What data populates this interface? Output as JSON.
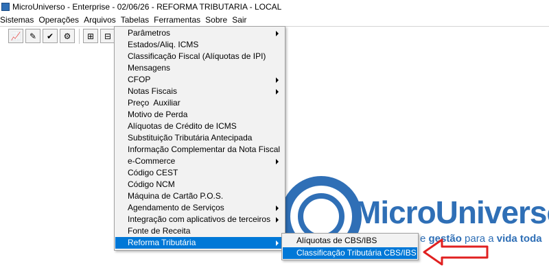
{
  "window": {
    "title": "MicroUniverso - Enterprise - 02/06/26 - REFORMA TRIBUTARIA - LOCAL"
  },
  "menubar": [
    "Sistemas",
    "Operações",
    "Arquivos",
    "Tabelas",
    "Ferramentas",
    "Sobre",
    "Sair"
  ],
  "toolbar": {
    "buttons": [
      {
        "icon": "chart-icon",
        "glyph": "📈"
      },
      {
        "icon": "edit-document-icon",
        "glyph": "✎"
      },
      {
        "icon": "check-icon",
        "glyph": "✔"
      },
      {
        "icon": "settings-document-icon",
        "glyph": "⚙"
      },
      {
        "icon": "tree-icon",
        "glyph": "⊞"
      },
      {
        "icon": "tree-alt-icon",
        "glyph": "⊟"
      }
    ]
  },
  "tabelas_menu": {
    "items": [
      {
        "label": "Parâmetros",
        "has_submenu": true
      },
      {
        "label": "Estados/Aliq. ICMS",
        "has_submenu": false
      },
      {
        "label": "Classificação Fiscal (Alíquotas de IPI)",
        "has_submenu": false
      },
      {
        "label": "Mensagens",
        "has_submenu": false
      },
      {
        "label": "CFOP",
        "has_submenu": true
      },
      {
        "label": "Notas Fiscais",
        "has_submenu": true
      },
      {
        "label": "Preço  Auxiliar",
        "has_submenu": false
      },
      {
        "label": "Motivo de Perda",
        "has_submenu": false
      },
      {
        "label": "Alíquotas de Crédito de ICMS",
        "has_submenu": false
      },
      {
        "label": "Substituição Tributária Antecipada",
        "has_submenu": false
      },
      {
        "label": "Informação Complementar da Nota Fiscal",
        "has_submenu": false
      },
      {
        "label": "e-Commerce",
        "has_submenu": true
      },
      {
        "label": "Código CEST",
        "has_submenu": false
      },
      {
        "label": "Código NCM",
        "has_submenu": false
      },
      {
        "label": "Máquina de Cartão P.O.S.",
        "has_submenu": false
      },
      {
        "label": "Agendamento de Serviços",
        "has_submenu": true
      },
      {
        "label": "Integração com aplicativos de terceiros",
        "has_submenu": true
      },
      {
        "label": "Fonte de Receita",
        "has_submenu": false
      },
      {
        "label": "Reforma Tributária",
        "has_submenu": true,
        "active": true
      }
    ]
  },
  "reforma_submenu": {
    "items": [
      {
        "label": "Alíquotas de CBS/IBS",
        "active": false
      },
      {
        "label": "Classificação Tributária CBS/IBS",
        "active": true
      }
    ]
  },
  "logo": {
    "name": "MicroUniverso",
    "tagline_prefix": "e ",
    "tagline_bold1": "gestão",
    "tagline_mid": " para a ",
    "tagline_bold2": "vida toda"
  },
  "colors": {
    "brand": "#2f6fb6",
    "highlight": "#0078d7",
    "annotation": "#e02020"
  }
}
